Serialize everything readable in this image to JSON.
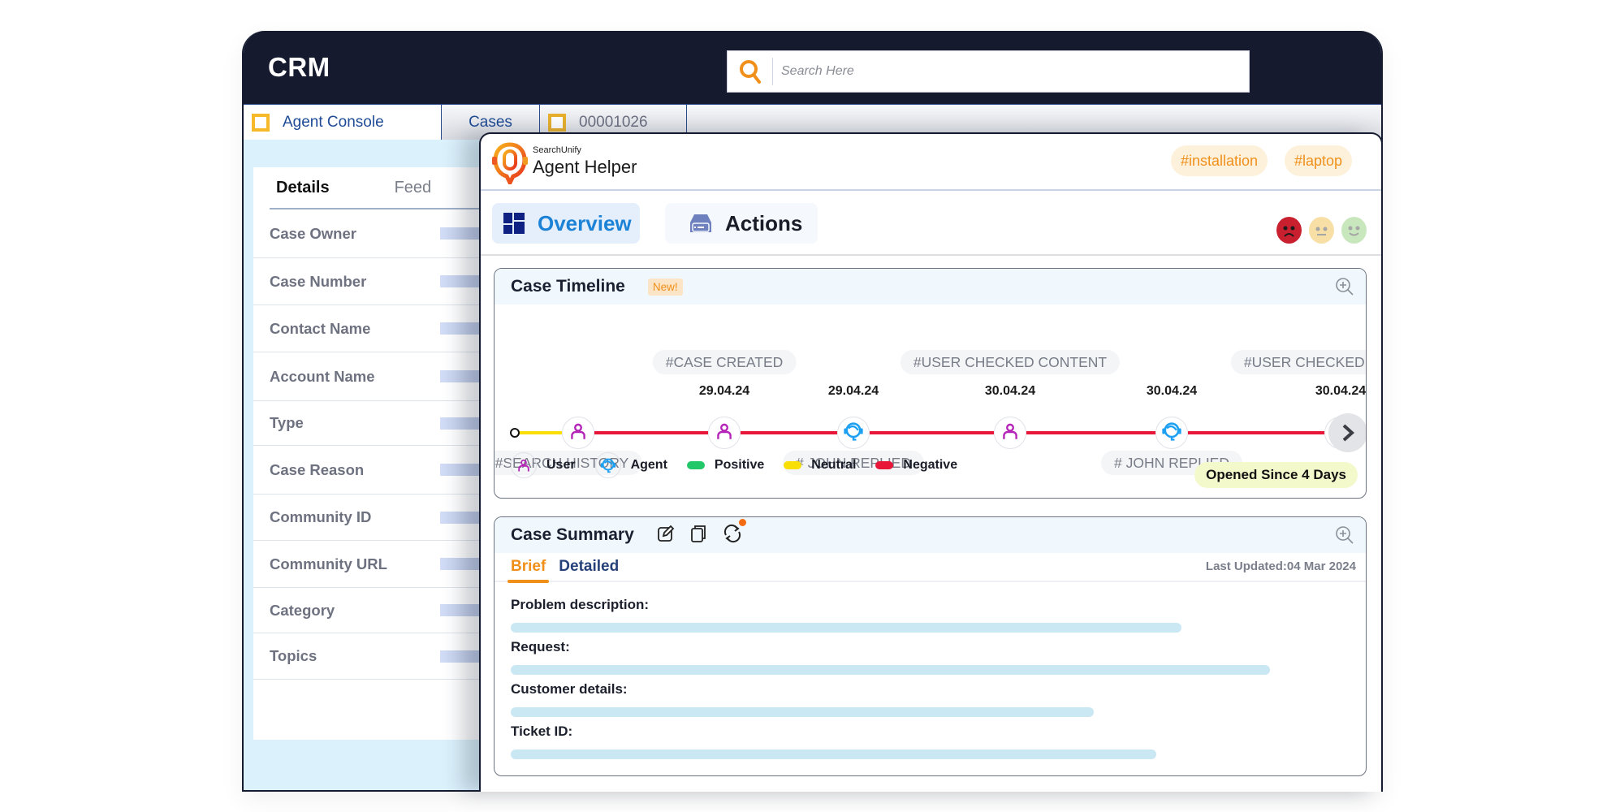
{
  "crm": {
    "title": "CRM",
    "search": {
      "placeholder": "Search Here",
      "value": ""
    },
    "tabs": [
      {
        "label": "Agent Console",
        "icon": "square-icon",
        "active": true
      },
      {
        "label": "Cases",
        "active": false
      },
      {
        "label": "00001026",
        "icon": "square-icon",
        "active": false
      }
    ],
    "details": {
      "tabs": [
        {
          "label": "Details",
          "active": true
        },
        {
          "label": "Feed",
          "active": false
        }
      ],
      "fields": [
        "Case Owner",
        "Case Number",
        "Contact Name",
        "Account Name",
        "Type",
        "Case Reason",
        "Community ID",
        "Community URL",
        "Category",
        "Topics"
      ]
    }
  },
  "helper": {
    "brand_small": "SearchUnify",
    "brand_name": "Agent Helper",
    "hashtags": [
      "#installation",
      "#laptop"
    ],
    "nav_tabs": [
      {
        "label": "Overview",
        "icon": "grid-icon",
        "active": true
      },
      {
        "label": "Actions",
        "icon": "inbox-icon",
        "active": false
      }
    ],
    "sentiment_icons": [
      {
        "name": "negative",
        "color": "#c8202f"
      },
      {
        "name": "neutral",
        "color": "#f8dfa6"
      },
      {
        "name": "positive",
        "color": "#c9e7bd"
      }
    ],
    "timeline": {
      "title": "Case Timeline",
      "badge": "New!",
      "events": [
        {
          "type": "user",
          "date": "",
          "tag_top": "",
          "tag_bottom": "#SEARCH HISTORY",
          "segment_before": "neutral"
        },
        {
          "type": "user",
          "date": "29.04.24",
          "tag_top": "#CASE CREATED",
          "tag_bottom": "",
          "segment_before": "negative"
        },
        {
          "type": "agent",
          "date": "29.04.24",
          "tag_top": "",
          "tag_bottom": "# JOHN REPLIED",
          "segment_before": "negative"
        },
        {
          "type": "user",
          "date": "30.04.24",
          "tag_top": "#USER CHECKED CONTENT",
          "tag_bottom": "",
          "segment_before": "negative"
        },
        {
          "type": "agent",
          "date": "30.04.24",
          "tag_top": "",
          "tag_bottom": "# JOHN REPLIED",
          "segment_before": "negative"
        },
        {
          "type": "user",
          "date": "30.04.24",
          "tag_top": "#USER CHECKED CONTENT",
          "tag_bottom": "",
          "segment_before": "negative"
        }
      ],
      "legend": [
        {
          "label": "User",
          "kind": "user"
        },
        {
          "label": "Agent",
          "kind": "agent"
        },
        {
          "label": "Positive",
          "color": "#22c76a"
        },
        {
          "label": "Neutral",
          "color": "#f9df06"
        },
        {
          "label": "Negative",
          "color": "#e8173a"
        }
      ],
      "status": "Opened Since 4 Days"
    },
    "summary": {
      "title": "Case Summary",
      "tabs": [
        {
          "label": "Brief",
          "active": true
        },
        {
          "label": "Detailed",
          "active": false
        }
      ],
      "last_updated": "Last Updated:04 Mar 2024",
      "sections": [
        {
          "label": "Problem description:",
          "fill": 0.8
        },
        {
          "label": "Request:",
          "fill": 0.905
        },
        {
          "label": "Customer details:",
          "fill": 0.695
        },
        {
          "label": "Ticket ID:",
          "fill": 0.77
        }
      ]
    }
  },
  "colors": {
    "header_bg": "#151a2f",
    "accent_orange": "#f0901a",
    "overview_blue": "#1c82d6",
    "user_purple": "#b524b8",
    "agent_blue": "#1da0f2",
    "positive": "#22c76a",
    "neutral": "#f9df06",
    "negative": "#e8173a"
  }
}
